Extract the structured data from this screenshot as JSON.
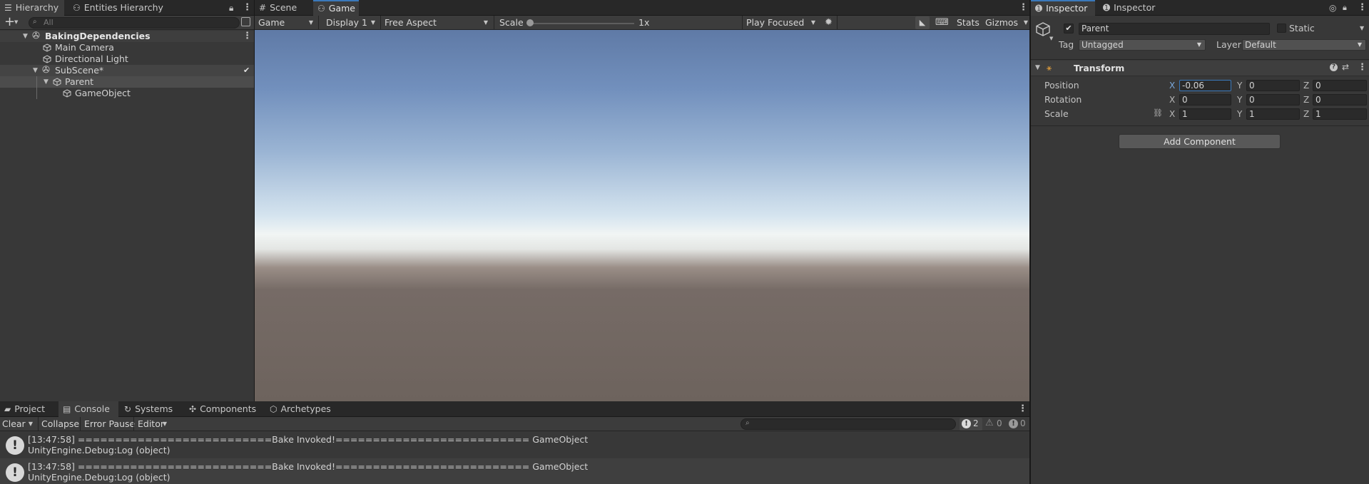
{
  "hierarchy": {
    "tabs": [
      {
        "label": "Hierarchy",
        "icon": "list-icon"
      },
      {
        "label": "Entities Hierarchy",
        "icon": "entities-icon"
      }
    ],
    "search_placeholder": "All",
    "items": [
      {
        "label": "BakingDependencies",
        "type": "scene"
      },
      {
        "label": "Main Camera",
        "type": "gameobject"
      },
      {
        "label": "Directional Light",
        "type": "gameobject"
      },
      {
        "label": "SubScene*",
        "type": "subscene"
      },
      {
        "label": "Parent",
        "type": "gameobject"
      },
      {
        "label": "GameObject",
        "type": "gameobject"
      }
    ]
  },
  "game_view": {
    "tabs": [
      {
        "label": "Scene",
        "icon": "grid-icon"
      },
      {
        "label": "Game",
        "icon": "gamepad-icon"
      }
    ],
    "toolbar": {
      "view_mode": "Game",
      "display": "Display 1",
      "aspect": "Free Aspect",
      "scale_label": "Scale",
      "scale_value": "1x",
      "scale_fraction": 0.0,
      "play_mode": "Play Focused",
      "stats": "Stats",
      "gizmos": "Gizmos"
    },
    "colors": {
      "sky_top": "#6a88b5",
      "horizon": "#f2f4f2",
      "ground": "#6d635d"
    }
  },
  "console": {
    "tabs": [
      {
        "label": "Project",
        "icon": "folder-icon"
      },
      {
        "label": "Console",
        "icon": "console-icon"
      },
      {
        "label": "Systems",
        "icon": "systems-icon"
      },
      {
        "label": "Components",
        "icon": "components-icon"
      },
      {
        "label": "Archetypes",
        "icon": "archetypes-icon"
      }
    ],
    "toolbar": {
      "clear": "Clear",
      "collapse": "Collapse",
      "error_pause": "Error Pause",
      "editor": "Editor",
      "log_count": "2",
      "warning_count": "0",
      "error_count": "0"
    },
    "entries": [
      {
        "line1": "[13:47:58] ==========================Bake Invoked!========================== GameObject",
        "line2": "UnityEngine.Debug:Log (object)"
      },
      {
        "line1": "[13:47:58] ==========================Bake Invoked!========================== GameObject",
        "line2": "UnityEngine.Debug:Log (object)"
      }
    ]
  },
  "inspector": {
    "tabs": [
      {
        "label": "Inspector",
        "icon": "info-icon"
      },
      {
        "label": "Inspector",
        "icon": "info-icon"
      }
    ],
    "object_name": "Parent",
    "static_label": "Static",
    "tag_label": "Tag",
    "tag_value": "Untagged",
    "layer_label": "Layer",
    "layer_value": "Default",
    "transform": {
      "title": "Transform",
      "rows": [
        {
          "label": "Position",
          "x": "-0.06",
          "y": "0",
          "z": "0"
        },
        {
          "label": "Rotation",
          "x": "0",
          "y": "0",
          "z": "0"
        },
        {
          "label": "Scale",
          "x": "1",
          "y": "1",
          "z": "1"
        }
      ],
      "axis_labels": [
        "X",
        "Y",
        "Z"
      ]
    },
    "add_component": "Add Component"
  },
  "colors": {
    "accent": "#3a79bb",
    "panel": "#383838",
    "dark": "#282828"
  }
}
